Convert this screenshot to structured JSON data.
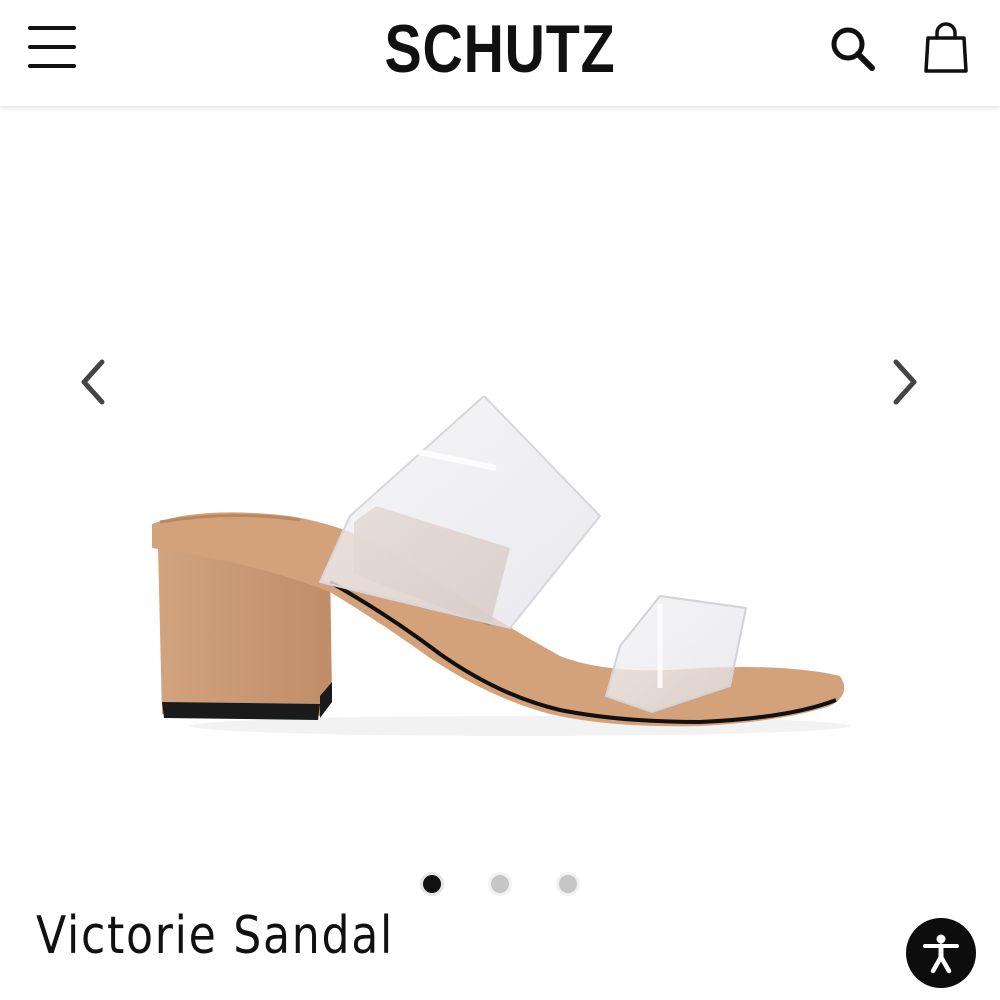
{
  "header": {
    "brand": "SCHUTZ",
    "menu_icon": "hamburger-menu-icon",
    "search_icon": "search-icon",
    "bag_icon": "shopping-bag-icon"
  },
  "gallery": {
    "prev_icon": "chevron-left-icon",
    "next_icon": "chevron-right-icon",
    "image_count": 3,
    "active_index": 0
  },
  "product": {
    "title": "Victorie Sandal"
  },
  "accessibility": {
    "icon": "accessibility-person-icon"
  },
  "colors": {
    "text": "#111111",
    "dot_inactive": "#c6c6c6",
    "dot_active": "#111111",
    "suede": "#c99a76"
  }
}
